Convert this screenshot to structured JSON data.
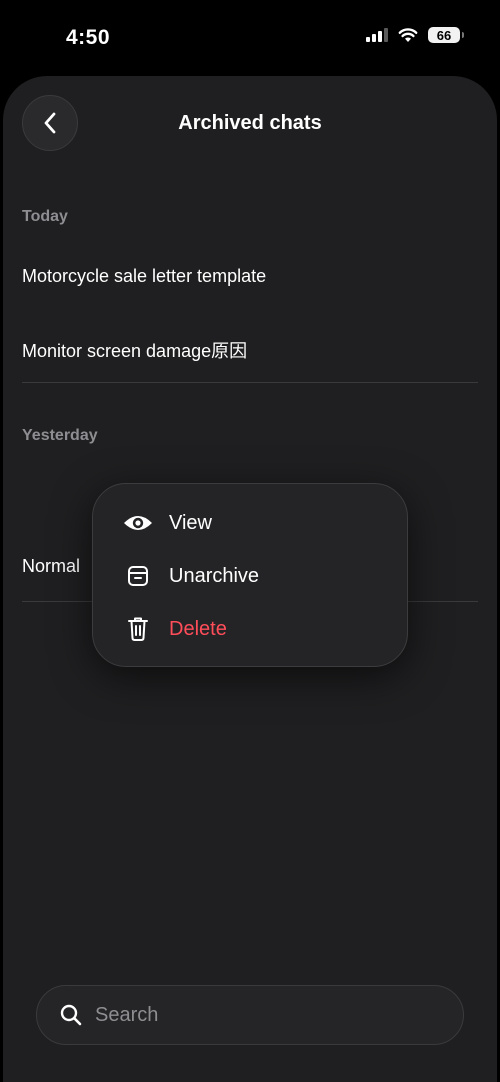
{
  "status_bar": {
    "time": "4:50",
    "battery_level": "66"
  },
  "header": {
    "title": "Archived chats",
    "back_icon": "chevron-left-icon"
  },
  "sections": [
    {
      "label": "Today",
      "items": [
        "Motorcycle sale letter template",
        "Monitor screen damage原因"
      ]
    },
    {
      "label": "Yesterday",
      "items": [
        "Normal"
      ]
    }
  ],
  "context_menu": {
    "items": [
      {
        "label": "View",
        "icon": "eye-icon"
      },
      {
        "label": "Unarchive",
        "icon": "archive-box-icon"
      },
      {
        "label": "Delete",
        "icon": "trash-icon",
        "color": "#ff4d5a"
      }
    ]
  },
  "search": {
    "placeholder": "Search"
  },
  "colors": {
    "background": "#1f1f21",
    "muted": "#8e8e92",
    "danger": "#ff4d5a"
  }
}
